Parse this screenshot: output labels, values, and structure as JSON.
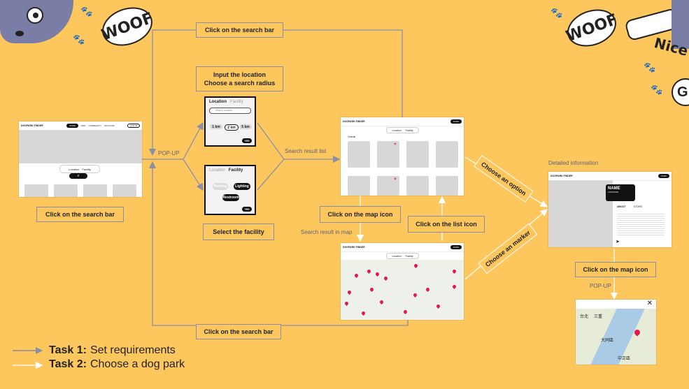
{
  "decor": {
    "woof_left": "WOOF",
    "woof_right": "WOOF",
    "nice_text": "Nice",
    "g_partial": "G",
    "paw_glyph": "🐾"
  },
  "steps": {
    "click_search_top": "Click on the search bar",
    "input_location": "Input the location",
    "choose_radius": "Choose a search radius",
    "click_search_left": "Click on the search bar",
    "select_facility": "Select the facility",
    "click_map_icon": "Click on the map icon",
    "click_list_icon": "Click on the list icon",
    "click_search_bottom": "Click on the search bar",
    "choose_option": "Choose an option",
    "choose_marker": "Choose an marker",
    "click_map_icon_right": "Click on the map icon"
  },
  "flow_labels": {
    "popup_left": "POP-UP",
    "search_result_list": "Search result list",
    "search_result_map": "Search result in map",
    "detailed_info": "Detailed information",
    "popup_right": "POP-UP"
  },
  "legend": [
    {
      "task": "Task 1:",
      "desc": "Set requirements",
      "color": "#6f7ea8"
    },
    {
      "task": "Task 2:",
      "desc": "Choose a dog park",
      "color": "#ffffff"
    }
  ],
  "screens": {
    "home": {
      "brand": "DOGPARK FINDER",
      "nav_active": "HOME",
      "nav_items": [
        "MAP",
        "COMMUNITY",
        "ACCOUNT"
      ],
      "login": "LOG IN",
      "location": "Location",
      "facility": "Facility"
    },
    "popup_location": {
      "tab_location": "Location",
      "tab_facility": "Facility",
      "search_placeholder": "Search location",
      "radii": [
        "1 km",
        "2 km",
        "5 km"
      ],
      "ok": "YES"
    },
    "popup_facility": {
      "tab_location": "Location",
      "tab_facility": "Facility",
      "options": [
        "Parking",
        "Lighting",
        "Restroom"
      ],
      "ok": "YES"
    },
    "list": {
      "brand": "DOGPARK FINDER",
      "nav_active": "PARK",
      "location": "Location",
      "facility": "Facility",
      "sort": "Overall"
    },
    "map": {
      "brand": "DOGPARK FINDER",
      "nav_active": "PARK",
      "location": "Location",
      "facility": "Facility"
    },
    "detail": {
      "brand": "DOGPARK FINDER",
      "nav_active": "PARK",
      "name": "NAME",
      "sub": "LOCATION",
      "tabs": [
        "ABOUT",
        "STORE"
      ]
    },
    "google_map": {
      "labels": [
        "台北",
        "三重",
        "大同區",
        "中正區"
      ]
    }
  }
}
